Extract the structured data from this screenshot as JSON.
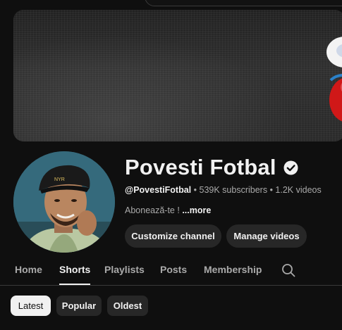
{
  "channel": {
    "name": "Povesti Fotbal",
    "handle": "@PovestiFotbal",
    "subscribers": "539K subscribers",
    "videos": "1.2K videos",
    "description": "Abonează-te ! ",
    "more_label": "...more",
    "verified": true
  },
  "actions": {
    "customize_label": "Customize channel",
    "manage_label": "Manage videos"
  },
  "tabs": [
    {
      "label": "Home",
      "active": false
    },
    {
      "label": "Shorts",
      "active": true
    },
    {
      "label": "Playlists",
      "active": false
    },
    {
      "label": "Posts",
      "active": false
    },
    {
      "label": "Membership",
      "active": false
    }
  ],
  "filters": [
    {
      "label": "Latest",
      "selected": true
    },
    {
      "label": "Popular",
      "selected": false
    },
    {
      "label": "Oldest",
      "selected": false
    }
  ],
  "icons": {
    "verified": "checkmark-circle-icon",
    "search": "search-icon"
  },
  "colors": {
    "background": "#0f0f0f",
    "chip_bg": "#272727",
    "text_primary": "#f1f1f1",
    "text_secondary": "#aaaaaa"
  }
}
